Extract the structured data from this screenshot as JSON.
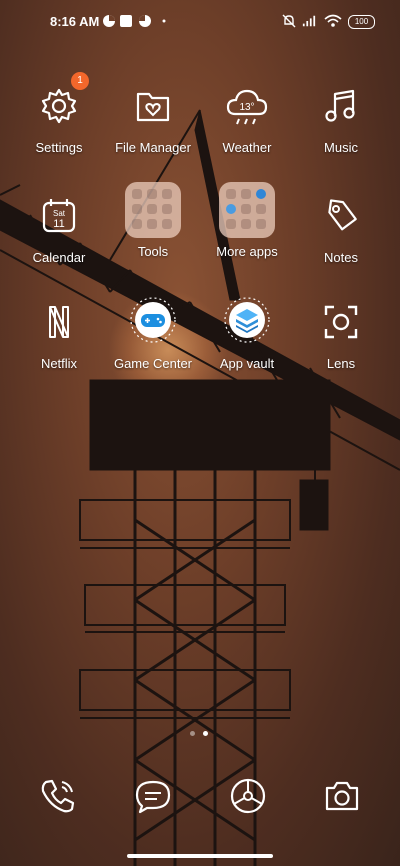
{
  "status_bar": {
    "time": "8:16 AM",
    "battery": "100"
  },
  "apps": [
    {
      "label": "Settings",
      "icon": "settings-icon",
      "badge": "1"
    },
    {
      "label": "File Manager",
      "icon": "folder-heart-icon"
    },
    {
      "label": "Weather",
      "icon": "weather-cloud-icon",
      "temp": "13°"
    },
    {
      "label": "Music",
      "icon": "music-note-icon"
    },
    {
      "label": "Calendar",
      "icon": "calendar-icon",
      "day": "Sat",
      "date": "11"
    },
    {
      "label": "Tools",
      "icon": "folder-icon"
    },
    {
      "label": "More apps",
      "icon": "folder-icon"
    },
    {
      "label": "Notes",
      "icon": "tag-icon"
    },
    {
      "label": "Netflix",
      "icon": "netflix-icon"
    },
    {
      "label": "Game Center",
      "icon": "gamepad-icon"
    },
    {
      "label": "App vault",
      "icon": "layers-icon"
    },
    {
      "label": "Lens",
      "icon": "lens-scan-icon"
    }
  ],
  "dock": [
    {
      "icon": "phone-icon"
    },
    {
      "icon": "messages-icon"
    },
    {
      "icon": "browser-icon"
    },
    {
      "icon": "camera-icon"
    }
  ],
  "page_indicator": {
    "pages": 2,
    "current": 2
  }
}
